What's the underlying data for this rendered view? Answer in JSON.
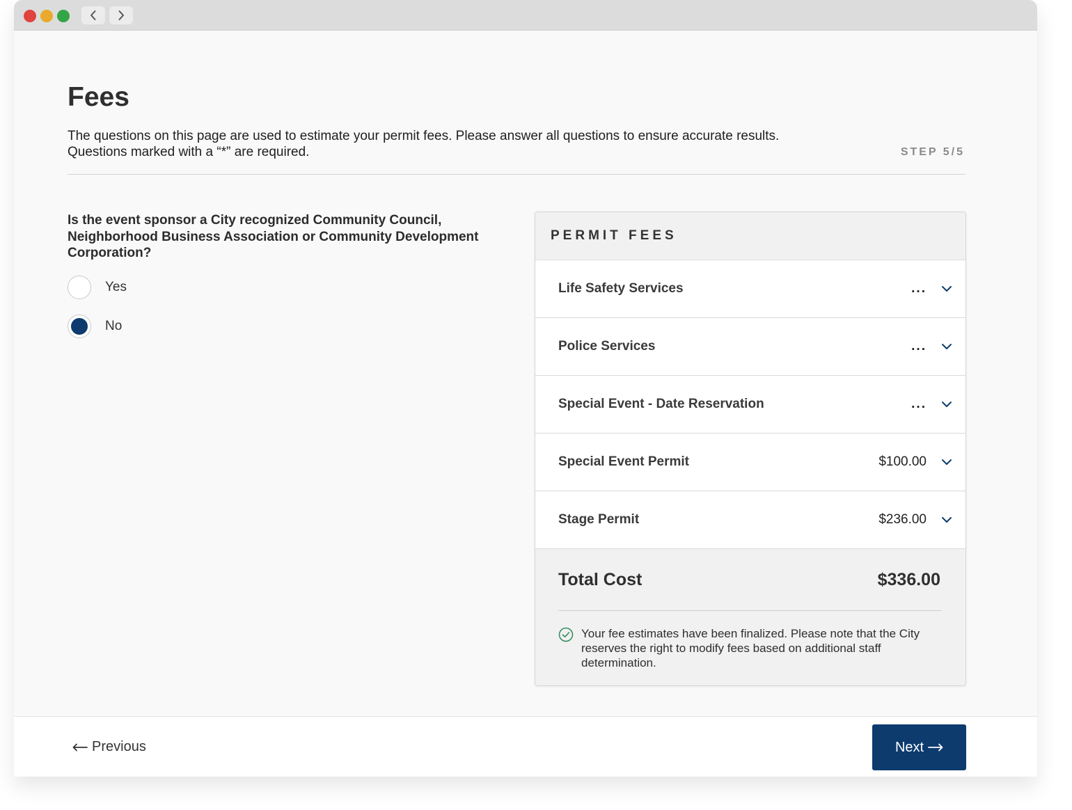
{
  "page": {
    "title": "Fees",
    "intro_line1": "The questions on this page are used to estimate your permit fees. Please answer all questions to ensure accurate results.",
    "intro_line2": "Questions marked with a “*” are required.",
    "step": "STEP 5/5"
  },
  "question": {
    "text": "Is the event sponsor a City recognized Community Council, Neighborhood Business Association or Community Development Corporation?",
    "options": [
      {
        "label": "Yes",
        "selected": false
      },
      {
        "label": "No",
        "selected": true
      }
    ]
  },
  "fees": {
    "header": "PERMIT FEES",
    "items": [
      {
        "name": "Life Safety Services",
        "amount": "..."
      },
      {
        "name": "Police Services",
        "amount": "..."
      },
      {
        "name": "Special Event - Date Reservation",
        "amount": "..."
      },
      {
        "name": "Special Event Permit",
        "amount": "$100.00"
      },
      {
        "name": "Stage Permit",
        "amount": "$236.00"
      }
    ],
    "total_label": "Total Cost",
    "total_value": "$336.00",
    "notice": "Your fee estimates have been finalized. Please note that the City reserves the right to modify fees based on additional staff determination."
  },
  "footer": {
    "previous_label": "Previous",
    "next_label": "Next"
  },
  "colors": {
    "primary": "#0d3b6e",
    "check_green": "#2f8a5a"
  }
}
